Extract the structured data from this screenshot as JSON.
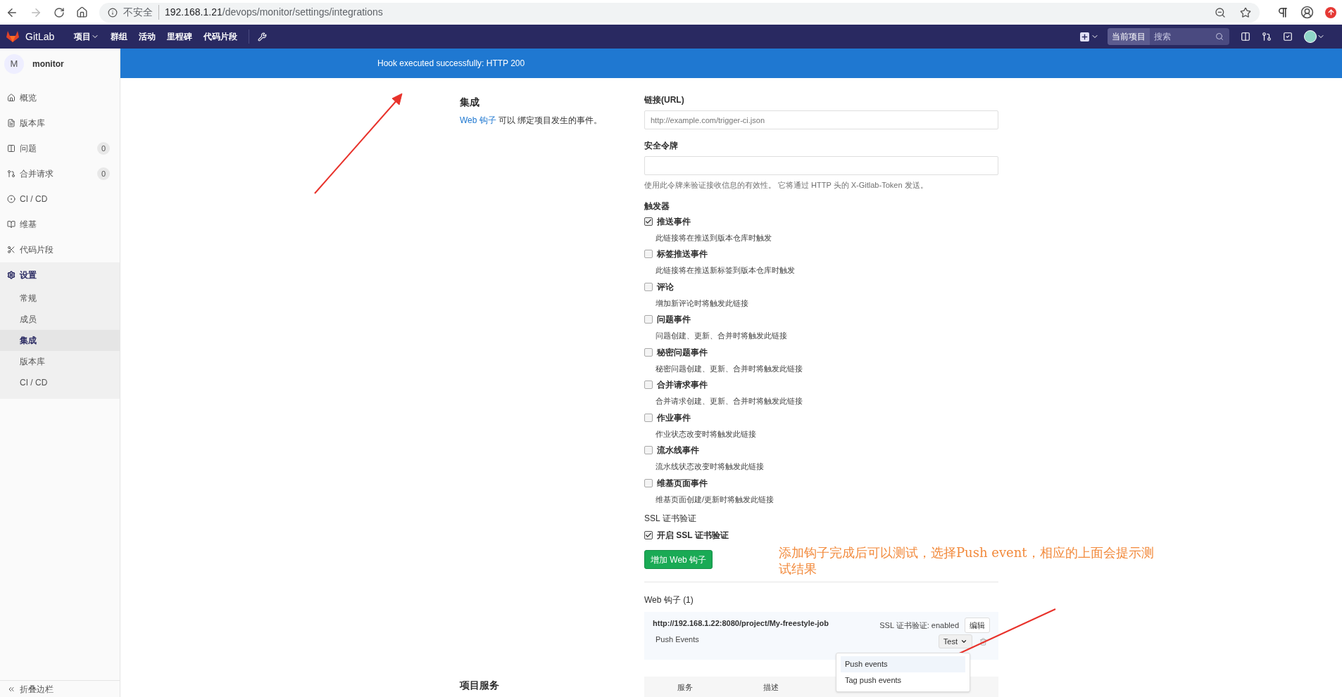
{
  "browser": {
    "security": "不安全",
    "host": "192.168.1.21",
    "path": "/devops/monitor/settings/integrations"
  },
  "nav": {
    "brand": "GitLab",
    "items": [
      {
        "label": "项目",
        "dropdown": true
      },
      {
        "label": "群组",
        "dropdown": false
      },
      {
        "label": "活动",
        "dropdown": false
      },
      {
        "label": "里程碑",
        "dropdown": false
      },
      {
        "label": "代码片段",
        "dropdown": false
      }
    ],
    "search": {
      "scope": "当前项目",
      "placeholder": "搜索"
    }
  },
  "sidebar": {
    "project": {
      "initial": "M",
      "name": "monitor"
    },
    "items": [
      {
        "label": "概览",
        "selected": false
      },
      {
        "label": "版本库",
        "selected": false
      },
      {
        "label": "问题",
        "count": "0",
        "selected": false
      },
      {
        "label": "合并请求",
        "count": "0",
        "selected": false
      },
      {
        "label": "CI / CD",
        "selected": false
      },
      {
        "label": "维基",
        "selected": false
      },
      {
        "label": "代码片段",
        "selected": false
      },
      {
        "label": "设置",
        "selected": true,
        "children": [
          {
            "label": "常规",
            "selected": false
          },
          {
            "label": "成员",
            "selected": false
          },
          {
            "label": "集成",
            "selected": true
          },
          {
            "label": "版本库",
            "selected": false
          },
          {
            "label": "CI / CD",
            "selected": false
          }
        ]
      }
    ],
    "collapse": "折叠边栏"
  },
  "flash": {
    "message": "Hook executed successfully: HTTP 200"
  },
  "section": {
    "title": "集成",
    "link": "Web 钩子",
    "description": "可以 绑定项目发生的事件。"
  },
  "form": {
    "url": {
      "label": "链接(URL)",
      "placeholder": "http://example.com/trigger-ci.json"
    },
    "token": {
      "label": "安全令牌",
      "help": "使用此令牌来验证接收信息的有效性。 它将通过 HTTP 头的 X-Gitlab-Token 发送。"
    },
    "triggers": {
      "label": "触发器",
      "items": [
        {
          "label": "推送事件",
          "description": "此链接将在推送到版本仓库时触发",
          "checked": true
        },
        {
          "label": "标签推送事件",
          "description": "此链接将在推送新标签到版本仓库时触发",
          "checked": false
        },
        {
          "label": "评论",
          "description": "增加新评论时将触发此链接",
          "checked": false
        },
        {
          "label": "问题事件",
          "description": "问题创建、更新、合并时将触发此链接",
          "checked": false
        },
        {
          "label": "秘密问题事件",
          "description": "秘密问题创建、更新、合并时将触发此链接",
          "checked": false
        },
        {
          "label": "合并请求事件",
          "description": "合并请求创建、更新、合并时将触发此链接",
          "checked": false
        },
        {
          "label": "作业事件",
          "description": "作业状态改变时将触发此链接",
          "checked": false
        },
        {
          "label": "流水线事件",
          "description": "流水线状态改变时将触发此链接",
          "checked": false
        },
        {
          "label": "维基页面事件",
          "description": "维基页面创建/更新时将触发此链接",
          "checked": false
        }
      ]
    },
    "ssl": {
      "label": "SSL 证书验证",
      "option": "开启 SSL 证书验证",
      "checked": true
    },
    "submit": "增加 Web 钩子"
  },
  "hooks": {
    "title": "Web 钩子 (1)",
    "items": [
      {
        "url": "http://192.168.1.22:8080/project/My-freestyle-job",
        "events": "Push Events",
        "ssl_label": "SSL 证书验证:",
        "ssl_value": "enabled",
        "edit": "编辑",
        "test": "Test"
      }
    ],
    "menu": [
      {
        "label": "Push events",
        "selected": true
      },
      {
        "label": "Tag push events",
        "selected": false
      }
    ]
  },
  "services": {
    "title": "项目服务",
    "columns": [
      "服务",
      "描述"
    ]
  },
  "annotation": {
    "text": "添加钩子完成后可以测试，选择Push event，相应的上面会提示测试结果"
  }
}
